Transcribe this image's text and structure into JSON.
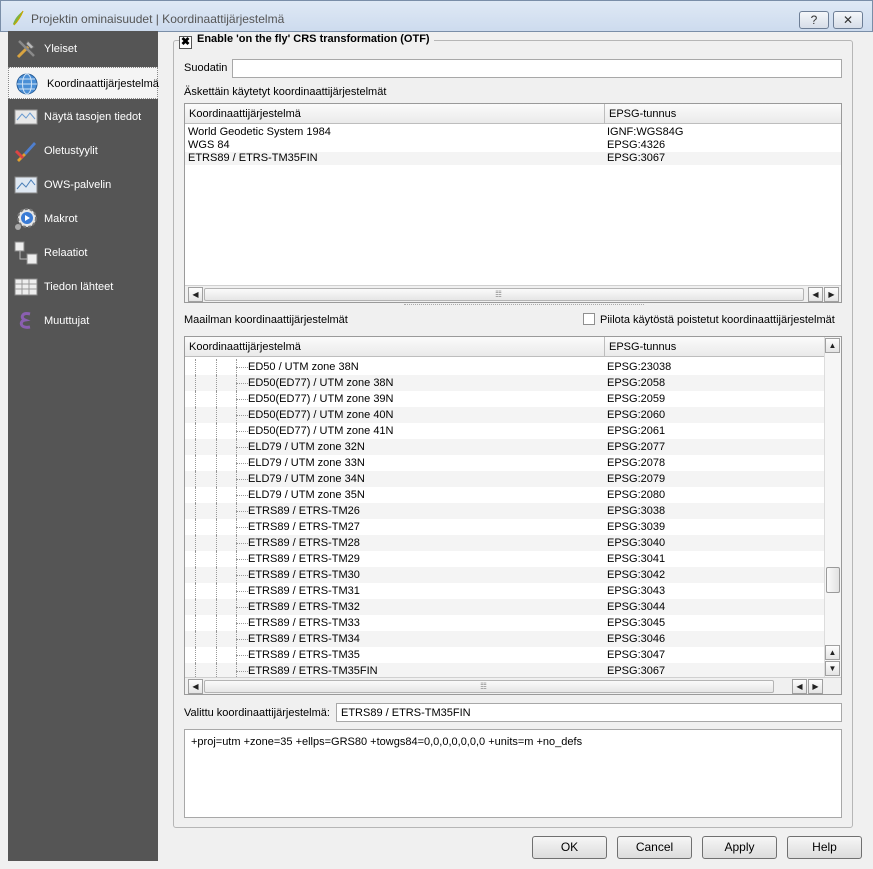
{
  "window": {
    "title": "Projektin ominaisuudet | Koordinaattijärjestelmä",
    "help_label": "?",
    "close_label": "✕"
  },
  "sidebar": {
    "items": [
      {
        "label": "Yleiset",
        "icon": "tools-icon"
      },
      {
        "label": "Koordinaattijärjestelmä",
        "icon": "globe-icon"
      },
      {
        "label": "Näytä tasojen tiedot",
        "icon": "map-layer-icon"
      },
      {
        "label": "Oletustyylit",
        "icon": "brush-icon"
      },
      {
        "label": "OWS-palvelin",
        "icon": "server-map-icon"
      },
      {
        "label": "Makrot",
        "icon": "gear-play-icon"
      },
      {
        "label": "Relaatiot",
        "icon": "relations-icon"
      },
      {
        "label": "Tiedon lähteet",
        "icon": "table-icon"
      },
      {
        "label": "Muuttujat",
        "icon": "epsilon-icon"
      }
    ],
    "active_index": 1
  },
  "otf": {
    "label": "Enable 'on the fly' CRS transformation (OTF)",
    "checked": true,
    "check_glyph": "✖"
  },
  "filter": {
    "label": "Suodatin",
    "value": ""
  },
  "recent": {
    "section_label": "Äskettäin käytetyt koordinaattijärjestelmät",
    "columns": [
      "Koordinaattijärjestelmä",
      "EPSG-tunnus"
    ],
    "rows": [
      {
        "name": "World Geodetic System 1984",
        "code": "IGNF:WGS84G"
      },
      {
        "name": "WGS 84",
        "code": "EPSG:4326"
      },
      {
        "name": "ETRS89 / ETRS-TM35FIN",
        "code": "EPSG:3067"
      }
    ]
  },
  "world": {
    "section_label": "Maailman koordinaattijärjestelmät",
    "hide_deprecated_label": "Piilota käytöstä poistetut koordinaattijärjestelmät",
    "hide_deprecated_checked": false,
    "columns": [
      "Koordinaattijärjestelmä",
      "EPSG-tunnus"
    ],
    "rows": [
      {
        "name": "ED50 / UTM zone 38N",
        "code": "EPSG:23038"
      },
      {
        "name": "ED50(ED77) / UTM zone 38N",
        "code": "EPSG:2058"
      },
      {
        "name": "ED50(ED77) / UTM zone 39N",
        "code": "EPSG:2059"
      },
      {
        "name": "ED50(ED77) / UTM zone 40N",
        "code": "EPSG:2060"
      },
      {
        "name": "ED50(ED77) / UTM zone 41N",
        "code": "EPSG:2061"
      },
      {
        "name": "ELD79 / UTM zone 32N",
        "code": "EPSG:2077"
      },
      {
        "name": "ELD79 / UTM zone 33N",
        "code": "EPSG:2078"
      },
      {
        "name": "ELD79 / UTM zone 34N",
        "code": "EPSG:2079"
      },
      {
        "name": "ELD79 / UTM zone 35N",
        "code": "EPSG:2080"
      },
      {
        "name": "ETRS89 / ETRS-TM26",
        "code": "EPSG:3038"
      },
      {
        "name": "ETRS89 / ETRS-TM27",
        "code": "EPSG:3039"
      },
      {
        "name": "ETRS89 / ETRS-TM28",
        "code": "EPSG:3040"
      },
      {
        "name": "ETRS89 / ETRS-TM29",
        "code": "EPSG:3041"
      },
      {
        "name": "ETRS89 / ETRS-TM30",
        "code": "EPSG:3042"
      },
      {
        "name": "ETRS89 / ETRS-TM31",
        "code": "EPSG:3043"
      },
      {
        "name": "ETRS89 / ETRS-TM32",
        "code": "EPSG:3044"
      },
      {
        "name": "ETRS89 / ETRS-TM33",
        "code": "EPSG:3045"
      },
      {
        "name": "ETRS89 / ETRS-TM34",
        "code": "EPSG:3046"
      },
      {
        "name": "ETRS89 / ETRS-TM35",
        "code": "EPSG:3047"
      },
      {
        "name": "ETRS89 / ETRS-TM35FIN",
        "code": "EPSG:3067"
      }
    ]
  },
  "selected": {
    "label": "Valittu koordinaattijärjestelmä:",
    "value": "ETRS89 / ETRS-TM35FIN",
    "proj4": "+proj=utm +zone=35 +ellps=GRS80 +towgs84=0,0,0,0,0,0,0 +units=m +no_defs"
  },
  "buttons": {
    "ok": "OK",
    "cancel": "Cancel",
    "apply": "Apply",
    "help": "Help"
  },
  "scroll_glyphs": {
    "left": "◀",
    "right": "▶",
    "up": "▲",
    "down": "▼",
    "grip": "⁞⁞⁞⁞"
  }
}
